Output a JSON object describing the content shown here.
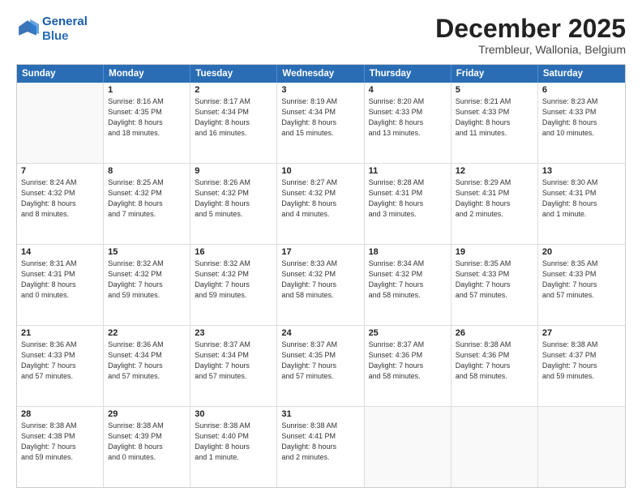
{
  "logo": {
    "line1": "General",
    "line2": "Blue"
  },
  "title": "December 2025",
  "subtitle": "Trembleur, Wallonia, Belgium",
  "header_days": [
    "Sunday",
    "Monday",
    "Tuesday",
    "Wednesday",
    "Thursday",
    "Friday",
    "Saturday"
  ],
  "weeks": [
    [
      {
        "day": "",
        "lines": []
      },
      {
        "day": "1",
        "lines": [
          "Sunrise: 8:16 AM",
          "Sunset: 4:35 PM",
          "Daylight: 8 hours",
          "and 18 minutes."
        ]
      },
      {
        "day": "2",
        "lines": [
          "Sunrise: 8:17 AM",
          "Sunset: 4:34 PM",
          "Daylight: 8 hours",
          "and 16 minutes."
        ]
      },
      {
        "day": "3",
        "lines": [
          "Sunrise: 8:19 AM",
          "Sunset: 4:34 PM",
          "Daylight: 8 hours",
          "and 15 minutes."
        ]
      },
      {
        "day": "4",
        "lines": [
          "Sunrise: 8:20 AM",
          "Sunset: 4:33 PM",
          "Daylight: 8 hours",
          "and 13 minutes."
        ]
      },
      {
        "day": "5",
        "lines": [
          "Sunrise: 8:21 AM",
          "Sunset: 4:33 PM",
          "Daylight: 8 hours",
          "and 11 minutes."
        ]
      },
      {
        "day": "6",
        "lines": [
          "Sunrise: 8:23 AM",
          "Sunset: 4:33 PM",
          "Daylight: 8 hours",
          "and 10 minutes."
        ]
      }
    ],
    [
      {
        "day": "7",
        "lines": [
          "Sunrise: 8:24 AM",
          "Sunset: 4:32 PM",
          "Daylight: 8 hours",
          "and 8 minutes."
        ]
      },
      {
        "day": "8",
        "lines": [
          "Sunrise: 8:25 AM",
          "Sunset: 4:32 PM",
          "Daylight: 8 hours",
          "and 7 minutes."
        ]
      },
      {
        "day": "9",
        "lines": [
          "Sunrise: 8:26 AM",
          "Sunset: 4:32 PM",
          "Daylight: 8 hours",
          "and 5 minutes."
        ]
      },
      {
        "day": "10",
        "lines": [
          "Sunrise: 8:27 AM",
          "Sunset: 4:32 PM",
          "Daylight: 8 hours",
          "and 4 minutes."
        ]
      },
      {
        "day": "11",
        "lines": [
          "Sunrise: 8:28 AM",
          "Sunset: 4:31 PM",
          "Daylight: 8 hours",
          "and 3 minutes."
        ]
      },
      {
        "day": "12",
        "lines": [
          "Sunrise: 8:29 AM",
          "Sunset: 4:31 PM",
          "Daylight: 8 hours",
          "and 2 minutes."
        ]
      },
      {
        "day": "13",
        "lines": [
          "Sunrise: 8:30 AM",
          "Sunset: 4:31 PM",
          "Daylight: 8 hours",
          "and 1 minute."
        ]
      }
    ],
    [
      {
        "day": "14",
        "lines": [
          "Sunrise: 8:31 AM",
          "Sunset: 4:31 PM",
          "Daylight: 8 hours",
          "and 0 minutes."
        ]
      },
      {
        "day": "15",
        "lines": [
          "Sunrise: 8:32 AM",
          "Sunset: 4:32 PM",
          "Daylight: 7 hours",
          "and 59 minutes."
        ]
      },
      {
        "day": "16",
        "lines": [
          "Sunrise: 8:32 AM",
          "Sunset: 4:32 PM",
          "Daylight: 7 hours",
          "and 59 minutes."
        ]
      },
      {
        "day": "17",
        "lines": [
          "Sunrise: 8:33 AM",
          "Sunset: 4:32 PM",
          "Daylight: 7 hours",
          "and 58 minutes."
        ]
      },
      {
        "day": "18",
        "lines": [
          "Sunrise: 8:34 AM",
          "Sunset: 4:32 PM",
          "Daylight: 7 hours",
          "and 58 minutes."
        ]
      },
      {
        "day": "19",
        "lines": [
          "Sunrise: 8:35 AM",
          "Sunset: 4:33 PM",
          "Daylight: 7 hours",
          "and 57 minutes."
        ]
      },
      {
        "day": "20",
        "lines": [
          "Sunrise: 8:35 AM",
          "Sunset: 4:33 PM",
          "Daylight: 7 hours",
          "and 57 minutes."
        ]
      }
    ],
    [
      {
        "day": "21",
        "lines": [
          "Sunrise: 8:36 AM",
          "Sunset: 4:33 PM",
          "Daylight: 7 hours",
          "and 57 minutes."
        ]
      },
      {
        "day": "22",
        "lines": [
          "Sunrise: 8:36 AM",
          "Sunset: 4:34 PM",
          "Daylight: 7 hours",
          "and 57 minutes."
        ]
      },
      {
        "day": "23",
        "lines": [
          "Sunrise: 8:37 AM",
          "Sunset: 4:34 PM",
          "Daylight: 7 hours",
          "and 57 minutes."
        ]
      },
      {
        "day": "24",
        "lines": [
          "Sunrise: 8:37 AM",
          "Sunset: 4:35 PM",
          "Daylight: 7 hours",
          "and 57 minutes."
        ]
      },
      {
        "day": "25",
        "lines": [
          "Sunrise: 8:37 AM",
          "Sunset: 4:36 PM",
          "Daylight: 7 hours",
          "and 58 minutes."
        ]
      },
      {
        "day": "26",
        "lines": [
          "Sunrise: 8:38 AM",
          "Sunset: 4:36 PM",
          "Daylight: 7 hours",
          "and 58 minutes."
        ]
      },
      {
        "day": "27",
        "lines": [
          "Sunrise: 8:38 AM",
          "Sunset: 4:37 PM",
          "Daylight: 7 hours",
          "and 59 minutes."
        ]
      }
    ],
    [
      {
        "day": "28",
        "lines": [
          "Sunrise: 8:38 AM",
          "Sunset: 4:38 PM",
          "Daylight: 7 hours",
          "and 59 minutes."
        ]
      },
      {
        "day": "29",
        "lines": [
          "Sunrise: 8:38 AM",
          "Sunset: 4:39 PM",
          "Daylight: 8 hours",
          "and 0 minutes."
        ]
      },
      {
        "day": "30",
        "lines": [
          "Sunrise: 8:38 AM",
          "Sunset: 4:40 PM",
          "Daylight: 8 hours",
          "and 1 minute."
        ]
      },
      {
        "day": "31",
        "lines": [
          "Sunrise: 8:38 AM",
          "Sunset: 4:41 PM",
          "Daylight: 8 hours",
          "and 2 minutes."
        ]
      },
      {
        "day": "",
        "lines": []
      },
      {
        "day": "",
        "lines": []
      },
      {
        "day": "",
        "lines": []
      }
    ]
  ]
}
